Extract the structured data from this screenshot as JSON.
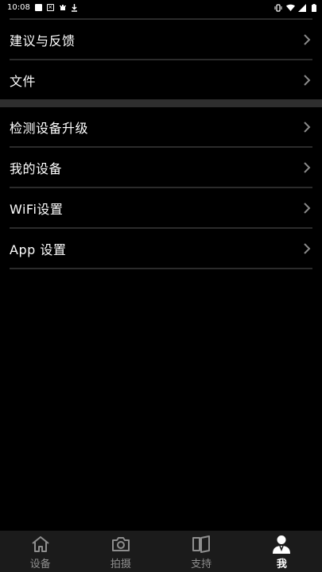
{
  "status_bar": {
    "time": "10:08",
    "icons_left": [
      "gallery-icon",
      "x-icon",
      "bug-icon",
      "download-icon"
    ],
    "icons_right": [
      "vibrate-icon",
      "wifi-icon",
      "signal-icon",
      "battery-icon"
    ]
  },
  "menu": {
    "group1": [
      {
        "label": "建议与反馈"
      },
      {
        "label": "文件"
      }
    ],
    "group2": [
      {
        "label": "检测设备升级"
      },
      {
        "label": "我的设备"
      },
      {
        "label": "WiFi设置"
      },
      {
        "label": "App 设置"
      }
    ]
  },
  "tabs": [
    {
      "label": "设备",
      "icon": "home-icon",
      "active": false
    },
    {
      "label": "拍摄",
      "icon": "camera-icon",
      "active": false
    },
    {
      "label": "支持",
      "icon": "book-icon",
      "active": false
    },
    {
      "label": "我",
      "icon": "person-icon",
      "active": true
    }
  ],
  "colors": {
    "background": "#000000",
    "divider": "#2b2b2b",
    "tab_bar": "#1b1b1b",
    "inactive_tab": "#8e8e8e",
    "active_tab": "#ffffff"
  }
}
